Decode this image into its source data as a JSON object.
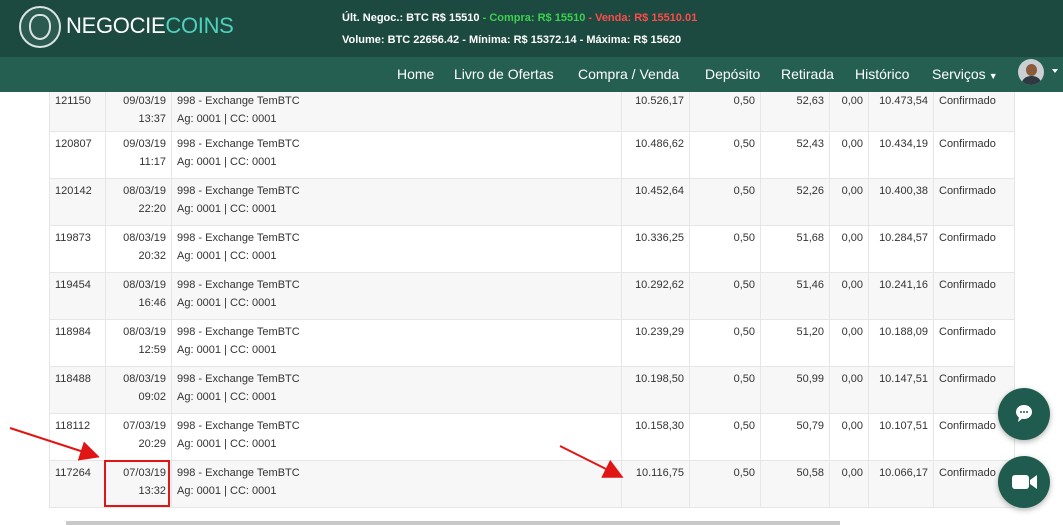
{
  "brand": {
    "part1": "NEGOCIE",
    "part2": "COINS"
  },
  "ticker": {
    "last_label": "Últ. Negoc.: BTC R$ 15510",
    "buy_label": " - Compra: R$ 15510",
    "sell_label": " - Venda: R$ 15510.01",
    "volume_label": "Volume: BTC 22656.42",
    "min_label": " - Mínima: R$ 15372.14",
    "max_label": " - Máxima: R$ 15620"
  },
  "nav": {
    "home": "Home",
    "offers": "Livro de Ofertas",
    "trade": "Compra / Venda",
    "deposit": "Depósito",
    "withdraw": "Retirada",
    "history": "Histórico",
    "services": "Serviços"
  },
  "rows": [
    {
      "id": "121150",
      "date": "09/03/19",
      "time": "13:37",
      "bank": "998 - Exchange TemBTC",
      "account": "Ag: 0001 | CC: 0001",
      "amount": "10.526,17",
      "fee_pct": "0,50",
      "fee": "52,63",
      "extra": "0,00",
      "net": "10.473,54",
      "status": "Confirmado"
    },
    {
      "id": "120807",
      "date": "09/03/19",
      "time": "11:17",
      "bank": "998 - Exchange TemBTC",
      "account": "Ag: 0001 | CC: 0001",
      "amount": "10.486,62",
      "fee_pct": "0,50",
      "fee": "52,43",
      "extra": "0,00",
      "net": "10.434,19",
      "status": "Confirmado"
    },
    {
      "id": "120142",
      "date": "08/03/19",
      "time": "22:20",
      "bank": "998 - Exchange TemBTC",
      "account": "Ag: 0001 | CC: 0001",
      "amount": "10.452,64",
      "fee_pct": "0,50",
      "fee": "52,26",
      "extra": "0,00",
      "net": "10.400,38",
      "status": "Confirmado"
    },
    {
      "id": "119873",
      "date": "08/03/19",
      "time": "20:32",
      "bank": "998 - Exchange TemBTC",
      "account": "Ag: 0001 | CC: 0001",
      "amount": "10.336,25",
      "fee_pct": "0,50",
      "fee": "51,68",
      "extra": "0,00",
      "net": "10.284,57",
      "status": "Confirmado"
    },
    {
      "id": "119454",
      "date": "08/03/19",
      "time": "16:46",
      "bank": "998 - Exchange TemBTC",
      "account": "Ag: 0001 | CC: 0001",
      "amount": "10.292,62",
      "fee_pct": "0,50",
      "fee": "51,46",
      "extra": "0,00",
      "net": "10.241,16",
      "status": "Confirmado"
    },
    {
      "id": "118984",
      "date": "08/03/19",
      "time": "12:59",
      "bank": "998 - Exchange TemBTC",
      "account": "Ag: 0001 | CC: 0001",
      "amount": "10.239,29",
      "fee_pct": "0,50",
      "fee": "51,20",
      "extra": "0,00",
      "net": "10.188,09",
      "status": "Confirmado"
    },
    {
      "id": "118488",
      "date": "08/03/19",
      "time": "09:02",
      "bank": "998 - Exchange TemBTC",
      "account": "Ag: 0001 | CC: 0001",
      "amount": "10.198,50",
      "fee_pct": "0,50",
      "fee": "50,99",
      "extra": "0,00",
      "net": "10.147,51",
      "status": "Confirmado"
    },
    {
      "id": "118112",
      "date": "07/03/19",
      "time": "20:29",
      "bank": "998 - Exchange TemBTC",
      "account": "Ag: 0001 | CC: 0001",
      "amount": "10.158,30",
      "fee_pct": "0,50",
      "fee": "50,79",
      "extra": "0,00",
      "net": "10.107,51",
      "status": "Confirmado"
    },
    {
      "id": "117264",
      "date": "07/03/19",
      "time": "13:32",
      "bank": "998 - Exchange TemBTC",
      "account": "Ag: 0001 | CC: 0001",
      "amount": "10.116,75",
      "fee_pct": "0,50",
      "fee": "50,58",
      "extra": "0,00",
      "net": "10.066,17",
      "status": "Confirmado"
    }
  ],
  "colors": {
    "header_bg": "#1c4a40",
    "nav_bg": "#245f52",
    "accent": "#4fd0bd",
    "buy": "#3fd04f",
    "sell": "#ff4a4a",
    "annotation": "#e01515"
  },
  "icons": {
    "chat_fab": "chat-bubble-icon",
    "video_fab": "video-camera-icon",
    "logo": "lion-head-icon"
  }
}
